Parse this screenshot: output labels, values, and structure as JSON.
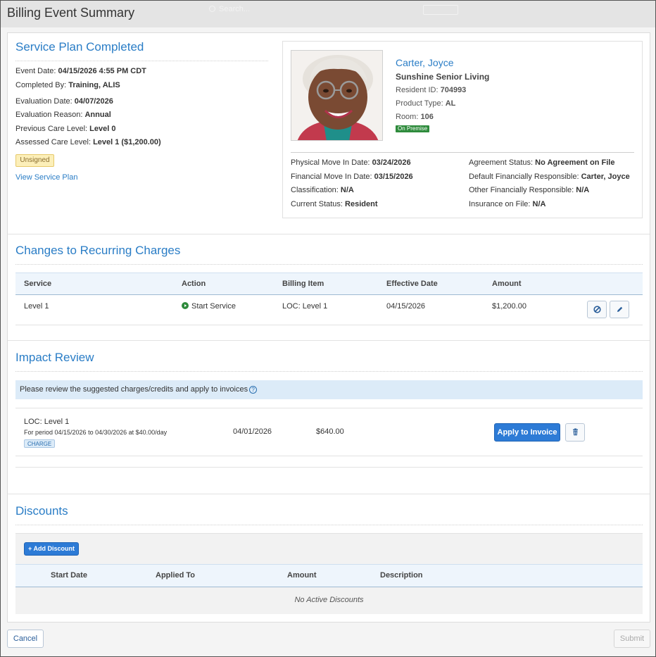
{
  "window": {
    "title": "Billing Event Summary",
    "search_placeholder": "Search..."
  },
  "event": {
    "title": "Service Plan Completed",
    "event_date_label": "Event Date:",
    "event_date": "04/15/2026 4:55 PM CDT",
    "completed_by_label": "Completed By:",
    "completed_by": "Training, ALIS",
    "evaluation_date_label": "Evaluation Date:",
    "evaluation_date": "04/07/2026",
    "evaluation_reason_label": "Evaluation Reason:",
    "evaluation_reason": "Annual",
    "previous_care_label": "Previous Care Level:",
    "previous_care": "Level 0",
    "assessed_care_label": "Assessed Care Level:",
    "assessed_care": "Level 1 ($1,200.00)",
    "status_badge": "Unsigned",
    "view_link": "View Service Plan"
  },
  "resident": {
    "name": "Carter, Joyce",
    "facility": "Sunshine Senior Living",
    "resident_id_label": "Resident ID:",
    "resident_id": "704993",
    "product_type_label": "Product Type:",
    "product_type": "AL",
    "room_label": "Room:",
    "room": "106",
    "location_badge": "On Premise",
    "physical_move_label": "Physical Move In Date:",
    "physical_move": "03/24/2026",
    "financial_move_label": "Financial Move In Date:",
    "financial_move": "03/15/2026",
    "classification_label": "Classification:",
    "classification": "N/A",
    "current_status_label": "Current Status:",
    "current_status": "Resident",
    "agreement_label": "Agreement Status:",
    "agreement": "No Agreement on File",
    "default_fin_label": "Default Financially Responsible:",
    "default_fin": "Carter, Joyce",
    "other_fin_label": "Other Financially Responsible:",
    "other_fin": "N/A",
    "insurance_label": "Insurance on File:",
    "insurance": "N/A"
  },
  "recurring": {
    "title": "Changes to Recurring Charges",
    "headers": [
      "Service",
      "Action",
      "Billing Item",
      "Effective Date",
      "Amount"
    ],
    "rows": [
      {
        "service": "Level 1",
        "action": "Start Service",
        "billing_item": "LOC: Level 1",
        "effective_date": "04/15/2026",
        "amount": "$1,200.00"
      }
    ]
  },
  "impact": {
    "title": "Impact Review",
    "info": "Please review the suggested charges/credits and apply to invoices",
    "items": [
      {
        "name": "LOC: Level 1",
        "period": "For period 04/15/2026 to 04/30/2026 at $40.00/day",
        "tag": "CHARGE",
        "date": "04/01/2026",
        "amount": "$640.00",
        "apply_label": "Apply to Invoice"
      }
    ]
  },
  "discounts": {
    "title": "Discounts",
    "add_label": "Add Discount",
    "headers": [
      "Start Date",
      "Applied To",
      "Amount",
      "Description"
    ],
    "empty": "No Active Discounts"
  },
  "footer": {
    "cancel": "Cancel",
    "submit": "Submit"
  },
  "colors": {
    "accent": "#2a7dc6",
    "primary_button": "#2d7bd6",
    "badge_warning": "#fcefb9",
    "badge_success": "#2e8b3c",
    "play_icon": "#2e8b3c"
  }
}
